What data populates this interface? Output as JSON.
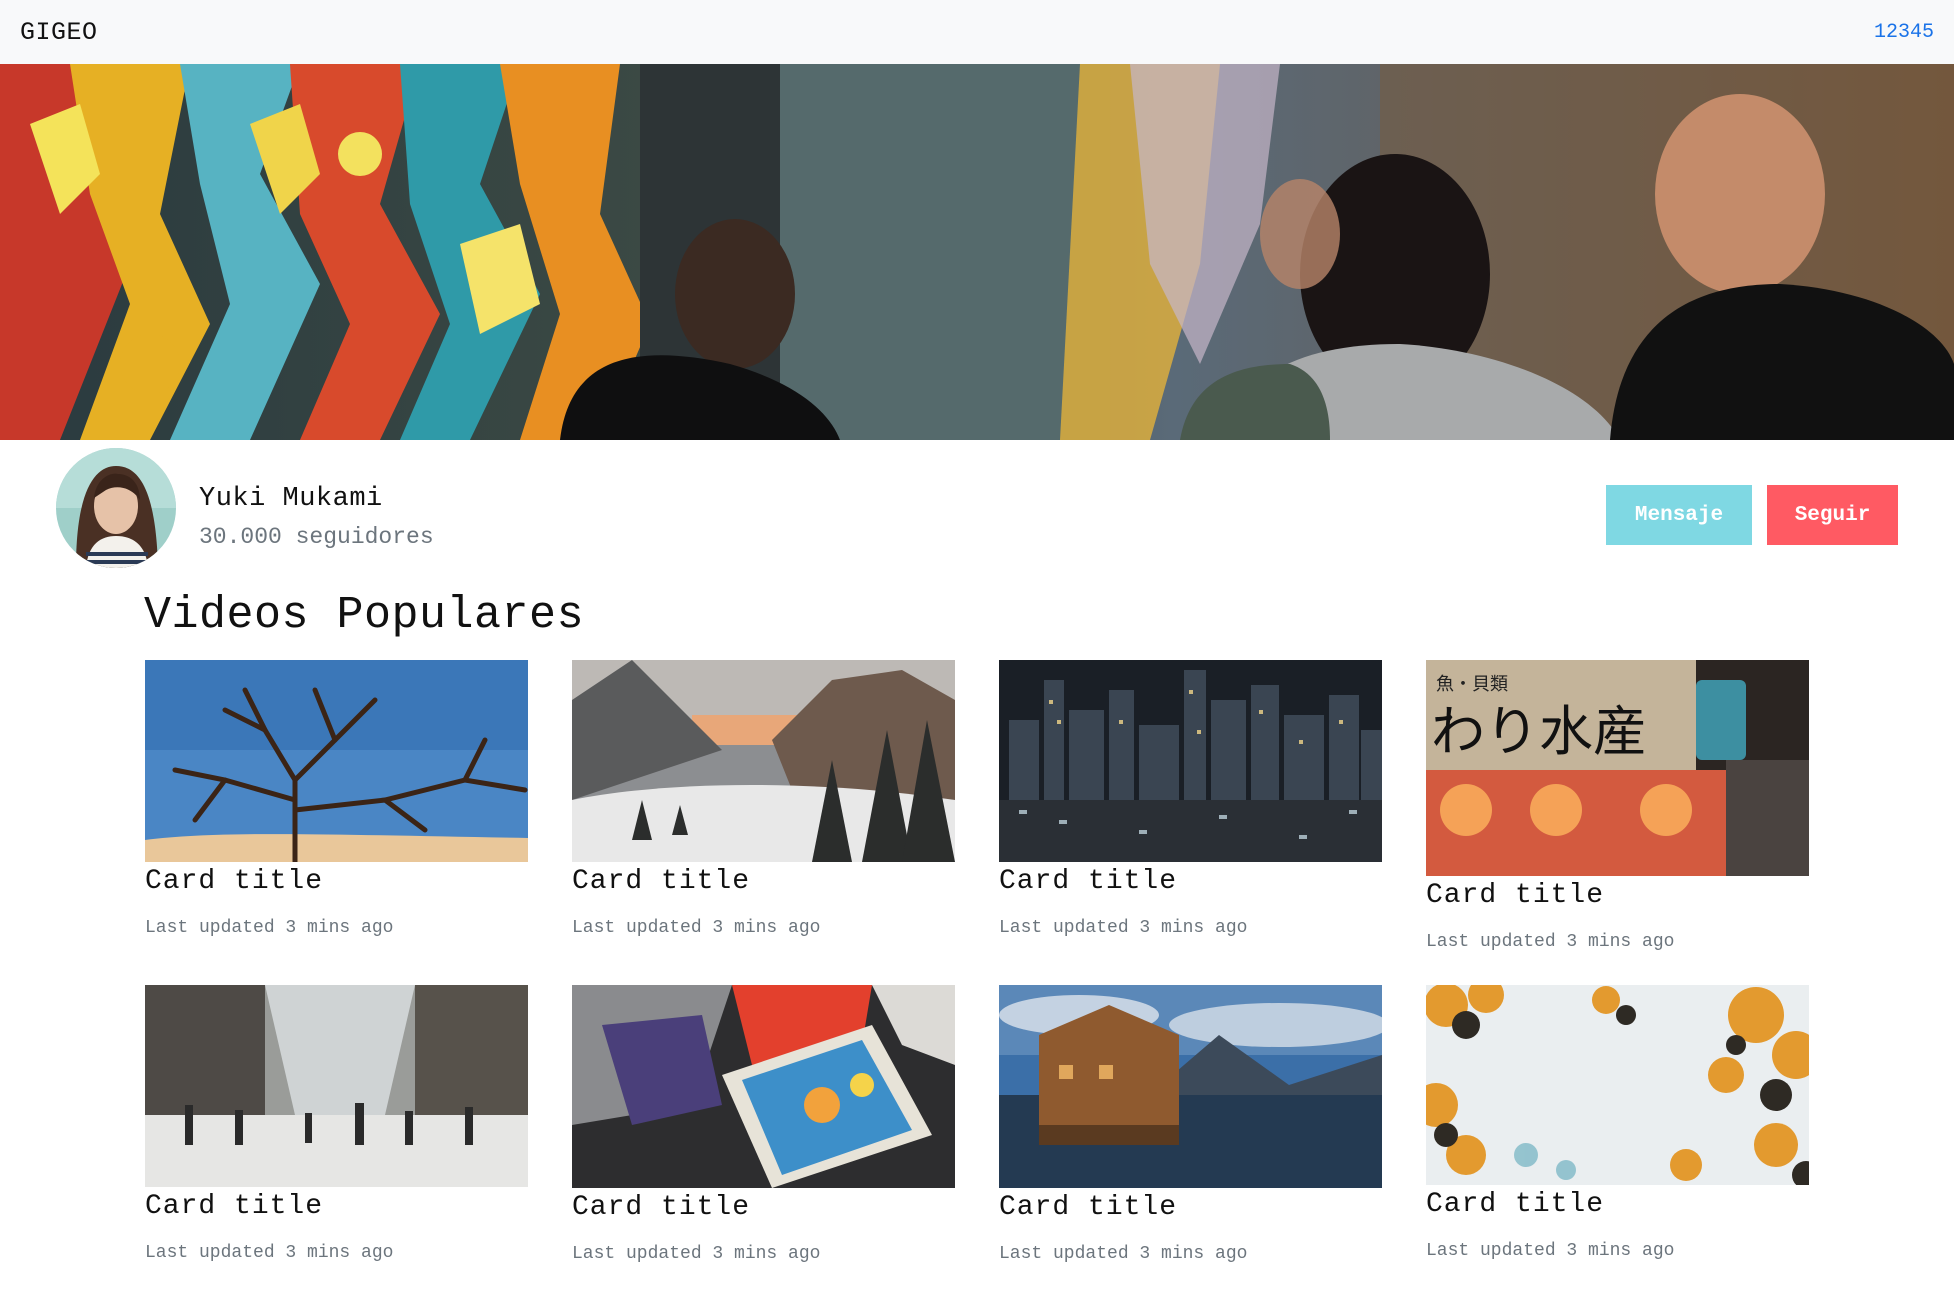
{
  "navbar": {
    "brand": "GIGEO",
    "link": "12345"
  },
  "banner": {
    "image": "street-art-crowd-photo"
  },
  "profile": {
    "name": "Yuki Mukami",
    "followers": "30.000 seguidores",
    "message_label": "Mensaje",
    "follow_label": "Seguir"
  },
  "section": {
    "title": "Videos Populares"
  },
  "cards": [
    {
      "title": "Card title",
      "meta": "Last updated 3 mins ago",
      "image": "bare-tree-blue-sky"
    },
    {
      "title": "Card title",
      "meta": "Last updated 3 mins ago",
      "image": "snowy-mountain-valley"
    },
    {
      "title": "Card title",
      "meta": "Last updated 3 mins ago",
      "image": "city-skyline-night"
    },
    {
      "title": "Card title",
      "meta": "Last updated 3 mins ago",
      "image": "japanese-shop-sign"
    },
    {
      "title": "Card title",
      "meta": "Last updated 3 mins ago",
      "image": "snowy-street-people"
    },
    {
      "title": "Card title",
      "meta": "Last updated 3 mins ago",
      "image": "magazine-stacks"
    },
    {
      "title": "Card title",
      "meta": "Last updated 3 mins ago",
      "image": "lake-boathouse"
    },
    {
      "title": "Card title",
      "meta": "Last updated 3 mins ago",
      "image": "autumn-leaves-sky"
    }
  ],
  "colors": {
    "navbar_bg": "#f8f9fa",
    "link": "#1a73e8",
    "message_button": "#7fd8e3",
    "follow_button": "#ff5a63",
    "muted_text": "#6c757d"
  }
}
